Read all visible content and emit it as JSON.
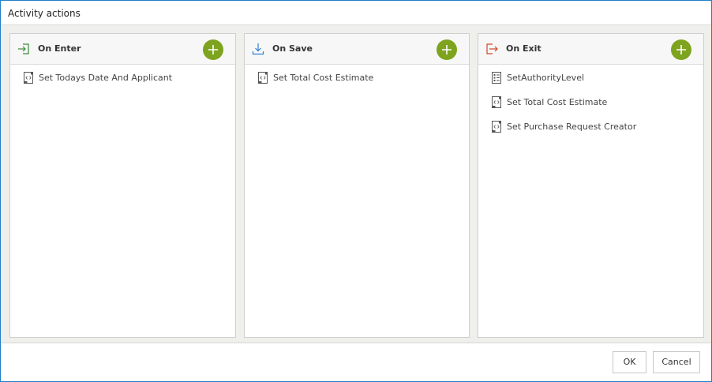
{
  "dialog": {
    "title": "Activity actions"
  },
  "panels": [
    {
      "title": "On Enter",
      "icon": "enter-icon",
      "items": [
        {
          "label": "Set Todays Date And Applicant",
          "icon": "script-icon"
        }
      ]
    },
    {
      "title": "On Save",
      "icon": "save-download-icon",
      "items": [
        {
          "label": "Set Total Cost Estimate",
          "icon": "script-icon"
        }
      ]
    },
    {
      "title": "On Exit",
      "icon": "exit-icon",
      "items": [
        {
          "label": "SetAuthorityLevel",
          "icon": "rules-list-icon"
        },
        {
          "label": "Set Total Cost Estimate",
          "icon": "script-icon"
        },
        {
          "label": "Set Purchase Request Creator",
          "icon": "script-icon"
        }
      ]
    }
  ],
  "footer": {
    "ok_label": "OK",
    "cancel_label": "Cancel"
  },
  "colors": {
    "accent_green": "#7ea31f",
    "enter_green": "#3a8a3a",
    "save_blue": "#2f7fd0",
    "exit_red": "#d0442c",
    "window_border": "#1e7fc8"
  }
}
